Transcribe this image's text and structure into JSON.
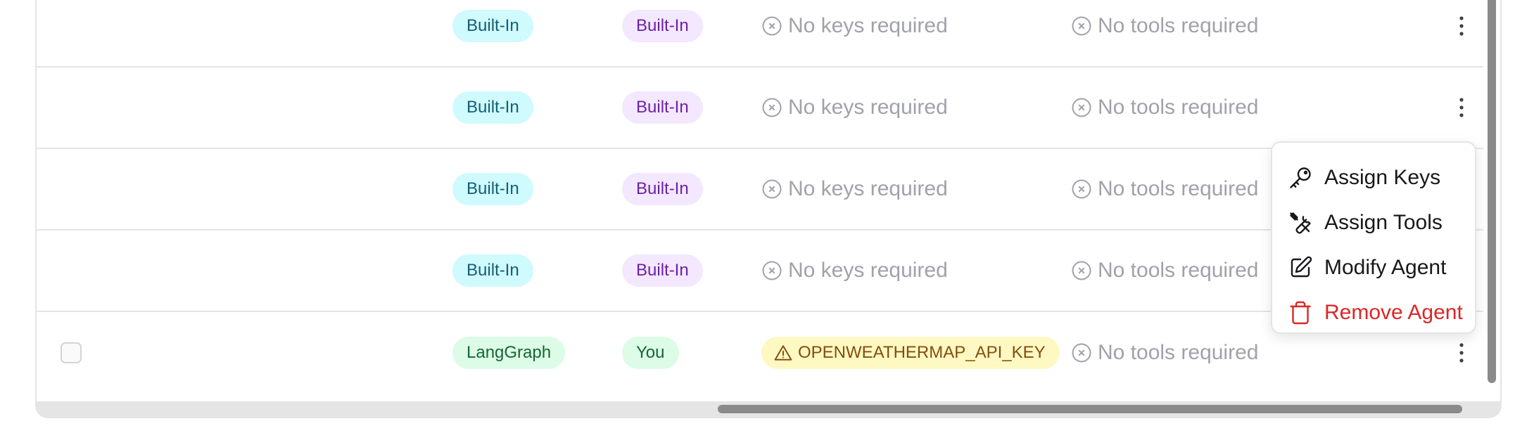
{
  "colors": {
    "cyan_badge_bg": "#cffafe",
    "cyan_badge_text": "#155e75",
    "purple_badge_bg": "#f3e8ff",
    "purple_badge_text": "#6b21a8",
    "green_badge_bg": "#dcfce7",
    "green_badge_text": "#166534",
    "warning_badge_bg": "#fef9c3",
    "warning_badge_text": "#854d0e",
    "danger": "#dc2626",
    "muted": "#a1a1aa"
  },
  "rows": [
    {
      "framework": "Built-In",
      "author": "Built-In",
      "keys": "No keys required",
      "tools": "No tools required"
    },
    {
      "framework": "Built-In",
      "author": "Built-In",
      "keys": "No keys required",
      "tools": "No tools required"
    },
    {
      "framework": "Built-In",
      "author": "Built-In",
      "keys": "No keys required",
      "tools": "No tools required"
    },
    {
      "framework": "Built-In",
      "author": "Built-In",
      "keys": "No keys required",
      "tools": "No tools required"
    },
    {
      "framework": "LangGraph",
      "author": "You",
      "keys": "OPENWEATHERMAP_API_KEY",
      "tools": "No tools required"
    }
  ],
  "menu": {
    "assign_keys": "Assign Keys",
    "assign_tools": "Assign Tools",
    "modify_agent": "Modify Agent",
    "remove_agent": "Remove Agent"
  },
  "icons": {
    "keys_missing": "x-circle-icon",
    "tools_missing": "x-circle-icon",
    "key_warning": "warning-triangle-icon",
    "row_actions": "more-vertical-icon",
    "assign_keys": "key-icon",
    "assign_tools": "tools-icon",
    "modify_agent": "edit-icon",
    "remove_agent": "trash-icon"
  }
}
